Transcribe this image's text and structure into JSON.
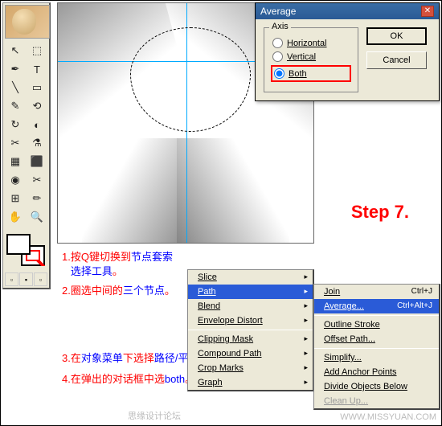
{
  "toolbox": {
    "tools": [
      "↖",
      "⬚",
      "✒",
      "T",
      "╲",
      "▭",
      "✎",
      "⟲",
      "↻",
      "◐",
      "✂",
      "⚗",
      "▦",
      "⬛",
      "◉",
      "✂",
      "⊞",
      "✏",
      "✋",
      "🔍"
    ],
    "bottom": [
      "▫",
      "▪",
      "▫"
    ]
  },
  "dialog": {
    "title": "Average",
    "group": "Axis",
    "opt_h": "Horizontal",
    "opt_v": "Vertical",
    "opt_b": "Both",
    "ok": "OK",
    "cancel": "Cancel"
  },
  "step": "Step 7.",
  "instructions": {
    "i1a": "1.按Q键切换到",
    "i1b": "节点套索",
    "i1c": "选择工具",
    "i1d": "。",
    "i2a": "2.圈选中间的",
    "i2b": "三个节点",
    "i2c": "。",
    "i3a": "3.在",
    "i3b": "对象菜单",
    "i3c": "下选择",
    "i3d": "路径/平均分配",
    "i3e": "。",
    "i4a": "4.在弹出的对话框中选",
    "i4b": "both",
    "i4c": "。"
  },
  "menu": {
    "items": [
      "Slice",
      "Path",
      "Blend",
      "Envelope Distort",
      "Clipping Mask",
      "Compound Path",
      "Crop Marks",
      "Graph"
    ]
  },
  "submenu": {
    "join": "Join",
    "join_sc": "Ctrl+J",
    "avg": "Average...",
    "avg_sc": "Ctrl+Alt+J",
    "outline": "Outline Stroke",
    "offset": "Offset Path...",
    "simplify": "Simplify...",
    "addpts": "Add Anchor Points",
    "divide": "Divide Objects Below",
    "cleanup": "Clean Up..."
  },
  "watermark": {
    "a": "思缘设计论坛",
    "b": "WWW.MISSYUAN.COM"
  }
}
